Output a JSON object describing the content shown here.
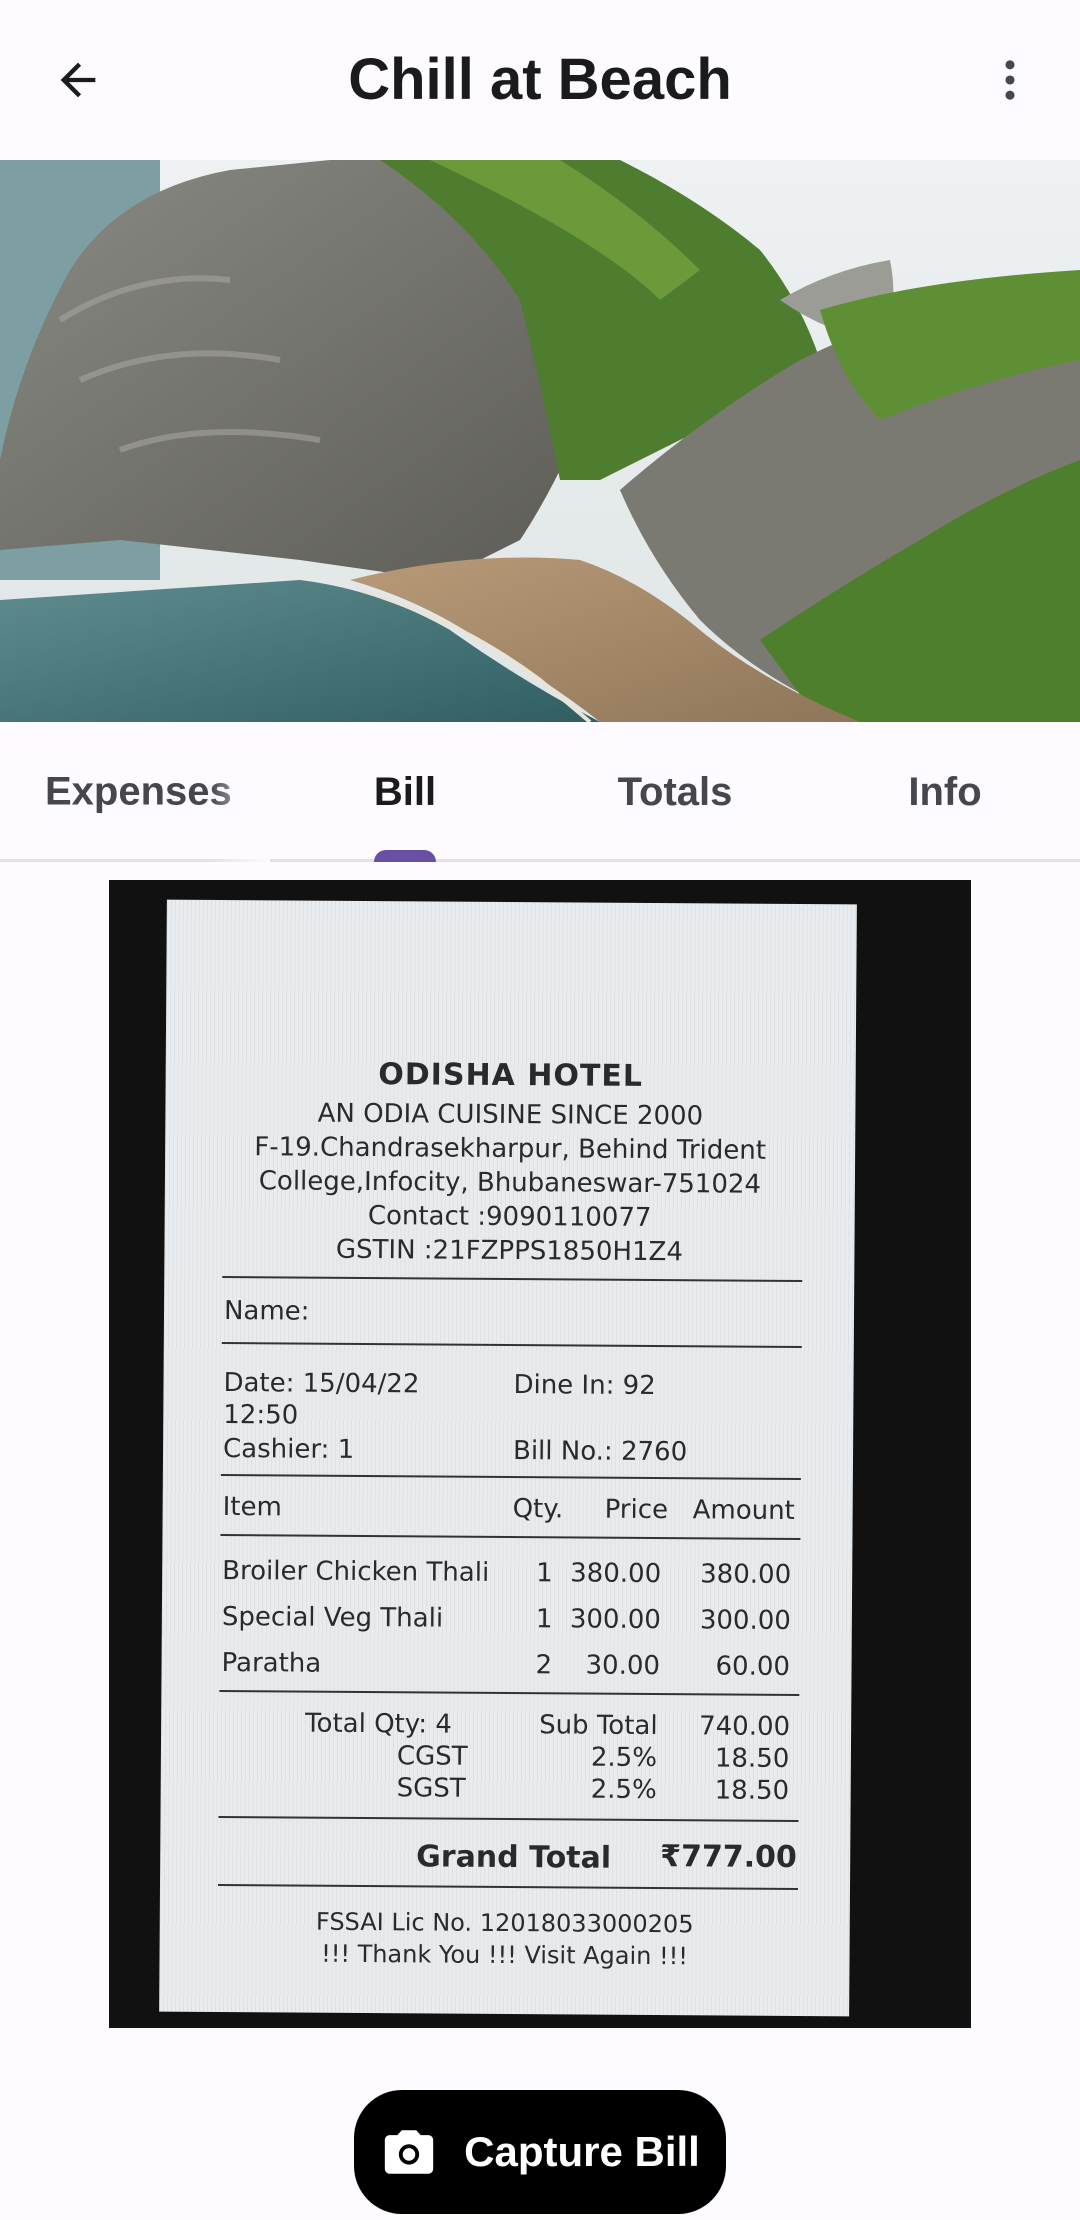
{
  "app_bar": {
    "title": "Chill at Beach",
    "back_icon": "arrow-back-icon",
    "more_icon": "more-vert-icon"
  },
  "hero": {
    "image": "beach-cliff-landscape"
  },
  "tabs": [
    {
      "label": "Expenses",
      "active": false
    },
    {
      "label": "Bill",
      "active": true
    },
    {
      "label": "Totals",
      "active": false
    },
    {
      "label": "Info",
      "active": false
    }
  ],
  "colors": {
    "accent": "#6750a4",
    "fab_background": "#000000",
    "background": "#fdfbff"
  },
  "bill": {
    "hotel_name": "ODISHA HOTEL",
    "tagline": "AN ODIA CUISINE SINCE 2000",
    "address_line1": "F-19.Chandrasekharpur, Behind Trident",
    "address_line2": "College,Infocity, Bhubaneswar-751024",
    "contact": "Contact :9090110077",
    "gstin": "GSTIN :21FZPPS1850H1Z4",
    "name_label": "Name:",
    "date": "Date: 15/04/22",
    "time": "12:50",
    "dine_in": "Dine In: 92",
    "cashier": "Cashier: 1",
    "bill_no": "Bill No.: 2760",
    "headers": {
      "item": "Item",
      "qty": "Qty.",
      "price": "Price",
      "amount": "Amount"
    },
    "items": [
      {
        "name": "Broiler Chicken Thali",
        "qty": "1",
        "price": "380.00",
        "amount": "380.00"
      },
      {
        "name": "Special Veg Thali",
        "qty": "1",
        "price": "300.00",
        "amount": "300.00"
      },
      {
        "name": "Paratha",
        "qty": "2",
        "price": "30.00",
        "amount": "60.00"
      }
    ],
    "total_qty": "Total Qty: 4",
    "sub_total_label": "Sub Total",
    "sub_total": "740.00",
    "cgst_label": "CGST",
    "cgst_rate": "2.5%",
    "cgst_amount": "18.50",
    "sgst_label": "SGST",
    "sgst_rate": "2.5%",
    "sgst_amount": "18.50",
    "grand_total_label": "Grand Total",
    "grand_total": "₹777.00",
    "fssai": "FSSAI Lic No. 12018033000205",
    "thanks": "!!! Thank You !!! Visit Again !!!"
  },
  "fab": {
    "label": "Capture Bill",
    "icon": "camera-icon"
  }
}
